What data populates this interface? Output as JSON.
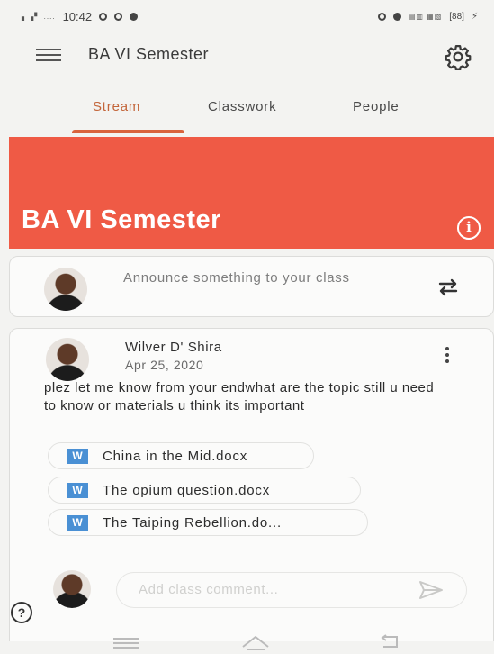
{
  "status_bar": {
    "time": "10:42",
    "battery": "[88]"
  },
  "app_bar": {
    "title": "BA VI Semester"
  },
  "tabs": [
    {
      "label": "Stream",
      "active": true
    },
    {
      "label": "Classwork",
      "active": false
    },
    {
      "label": "People",
      "active": false
    }
  ],
  "banner": {
    "title": "BA VI Semester",
    "color": "#ef5a45"
  },
  "announce": {
    "placeholder": "Announce something to your class"
  },
  "post": {
    "author": "Wilver D' Shira",
    "date": "Apr 25, 2020",
    "body": "plez let me know from your endwhat are the topic still u need to know or materials u think its important",
    "attachments": [
      {
        "icon": "W",
        "name": "China in the Mid.docx"
      },
      {
        "icon": "W",
        "name": "The opium question.docx"
      },
      {
        "icon": "W",
        "name": "The Taiping Rebellion.do..."
      }
    ],
    "comment_placeholder": "Add class comment..."
  },
  "help_icon": "?",
  "colors": {
    "accent": "#d9633d",
    "word_blue": "#4a90d4"
  }
}
